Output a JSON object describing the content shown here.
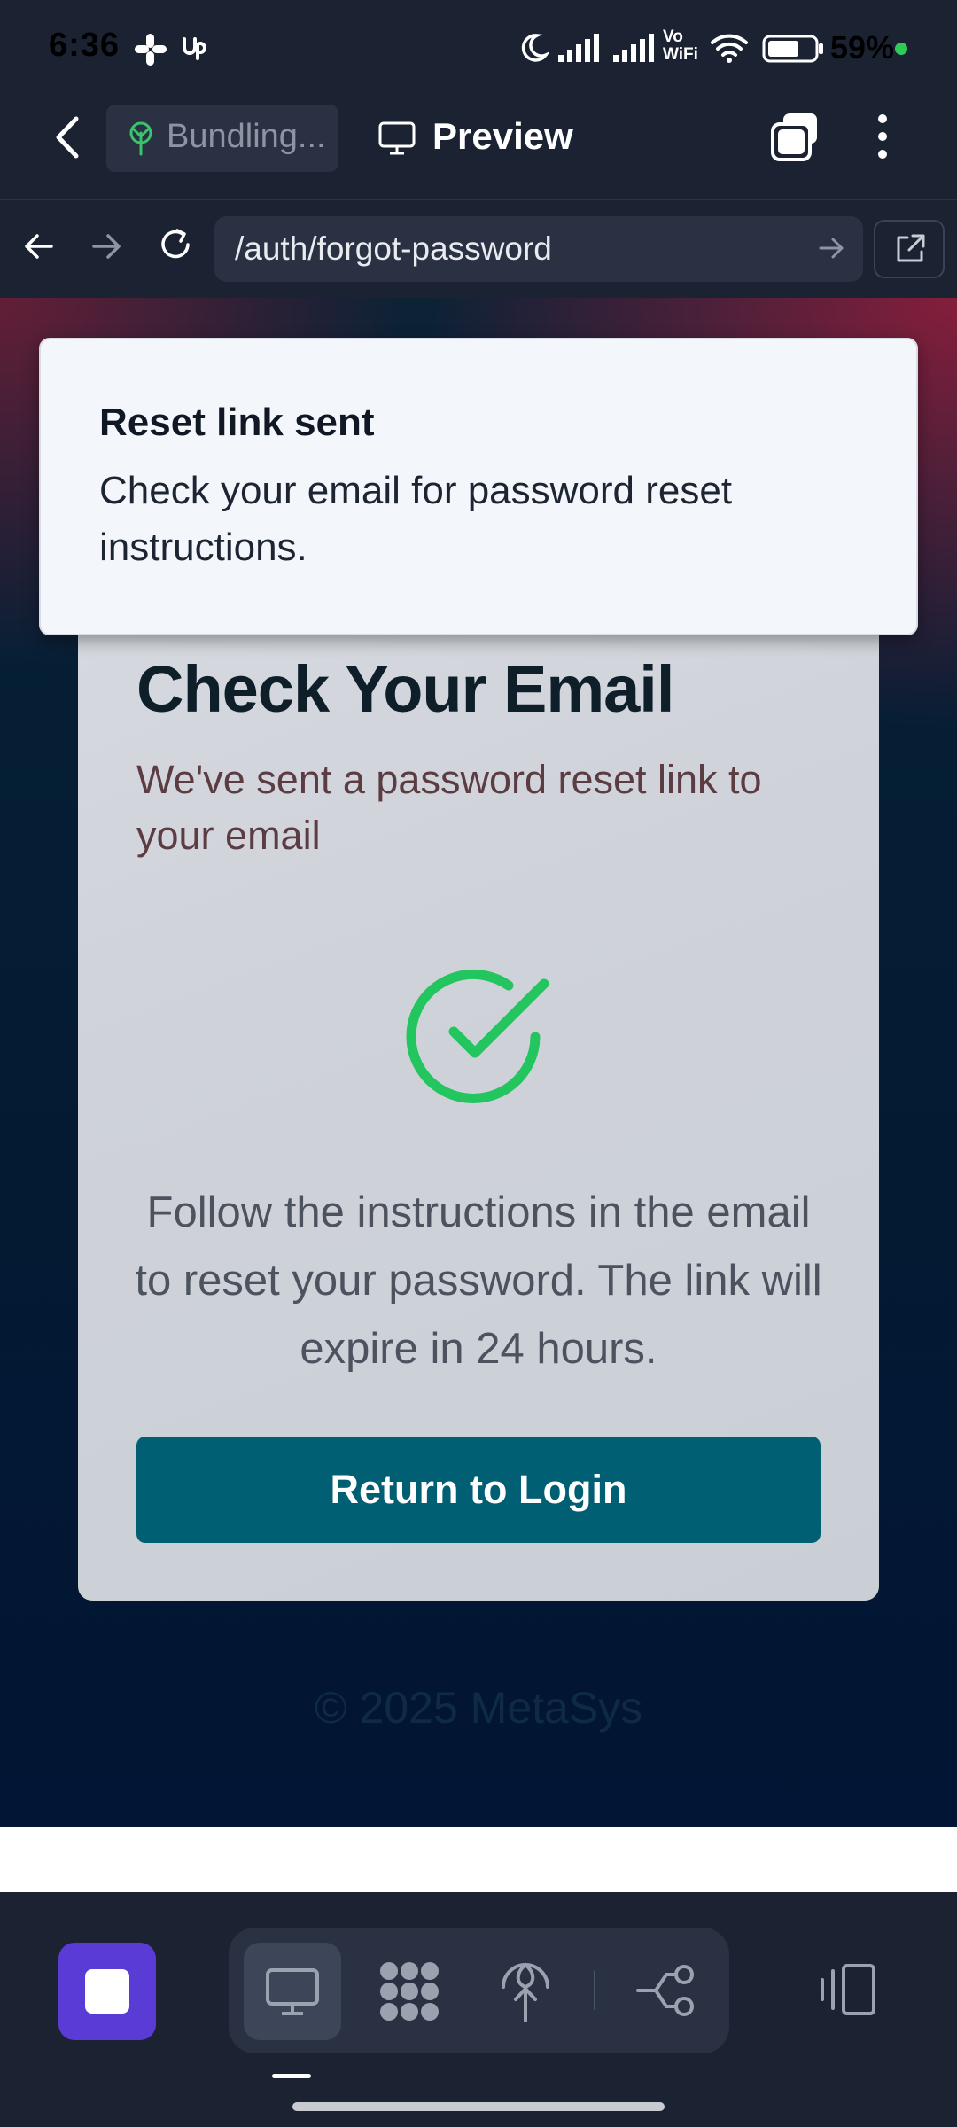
{
  "status_bar": {
    "time": "6:36",
    "network_label": "Vo WiFi",
    "battery": "59%"
  },
  "header": {
    "tab_label": "Bundling...",
    "title": "Preview"
  },
  "browser": {
    "url": "/auth/forgot-password"
  },
  "toast": {
    "title": "Reset link sent",
    "message": "Check your email for password reset instructions."
  },
  "card": {
    "title": "Check Your Email",
    "subtitle": "We've sent a password reset link to your email",
    "body": "Follow the instructions in the email to reset your password. The link will expire in 24 hours.",
    "button_label": "Return to Login"
  },
  "footer": {
    "copyright": "© 2025 MetaSys"
  },
  "colors": {
    "accent_primary": "#015f73",
    "success_green": "#22c55e",
    "stop_button": "#5b3bd6"
  },
  "icons": {
    "status": [
      "slack-icon",
      "upwork-icon",
      "moon-icon",
      "signal-icon",
      "wifi-icon",
      "battery-icon"
    ],
    "bottom_bar": [
      "stop-icon",
      "desktop-icon",
      "apps-icon",
      "deploy-icon",
      "flow-icon",
      "device-rotate-icon"
    ]
  }
}
